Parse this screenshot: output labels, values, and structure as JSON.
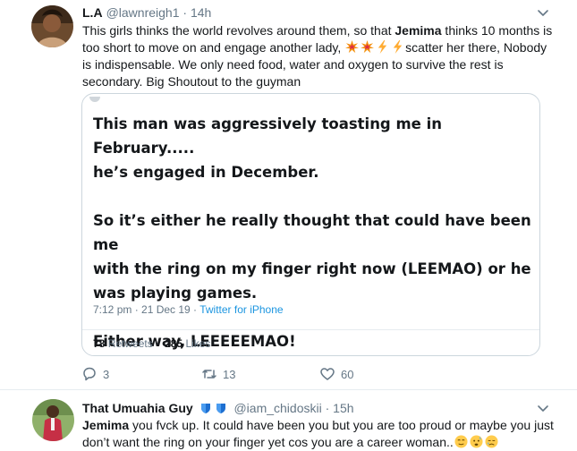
{
  "tweet1": {
    "name": "L.A",
    "handle": "@lawnreigh1",
    "separator": "·",
    "time": "14h",
    "text_part1": "This girls thinks the world revolves around them, so that ",
    "mention": "Jemima",
    "text_part2": " thinks 10 months is too short to move on and engage another lady, ",
    "text_part3": "scatter her there, Nobody is indispensable. We only need food, water and oxygen to survive the rest is secondary. Big Shoutout to the guyman",
    "quote": {
      "line1": "This man was aggressively toasting me in February.....",
      "line2": "he’s engaged in December.",
      "line3": "So it’s either he really thought that could have been me",
      "line4": "with the ring on my finger right now (LEEMAO) or he",
      "line5": "was playing games.",
      "line6": "Either way, LEEEEEMAO!",
      "timestamp": "7:12 pm · 21 Dec 19 · ",
      "source": "Twitter for iPhone",
      "retweets_count": "78",
      "retweets_label": "Retweets",
      "likes_count": "285",
      "likes_label": "Likes"
    },
    "actions": {
      "replies": "3",
      "retweets": "13",
      "likes": "60"
    }
  },
  "tweet2": {
    "name": "That Umuahia Guy",
    "handle": "@iam_chidoskii",
    "separator": "·",
    "time": "15h",
    "mention": "Jemima",
    "text": " you fvck up. It could have been you but you are too proud or maybe you just don’t  want the ring on your finger yet cos you are a career woman.."
  },
  "colors": {
    "text": "#14171a",
    "secondary": "#657786",
    "link": "#1b95e0",
    "border": "#e6ecf0",
    "verified_blue": "#1da1f2"
  }
}
